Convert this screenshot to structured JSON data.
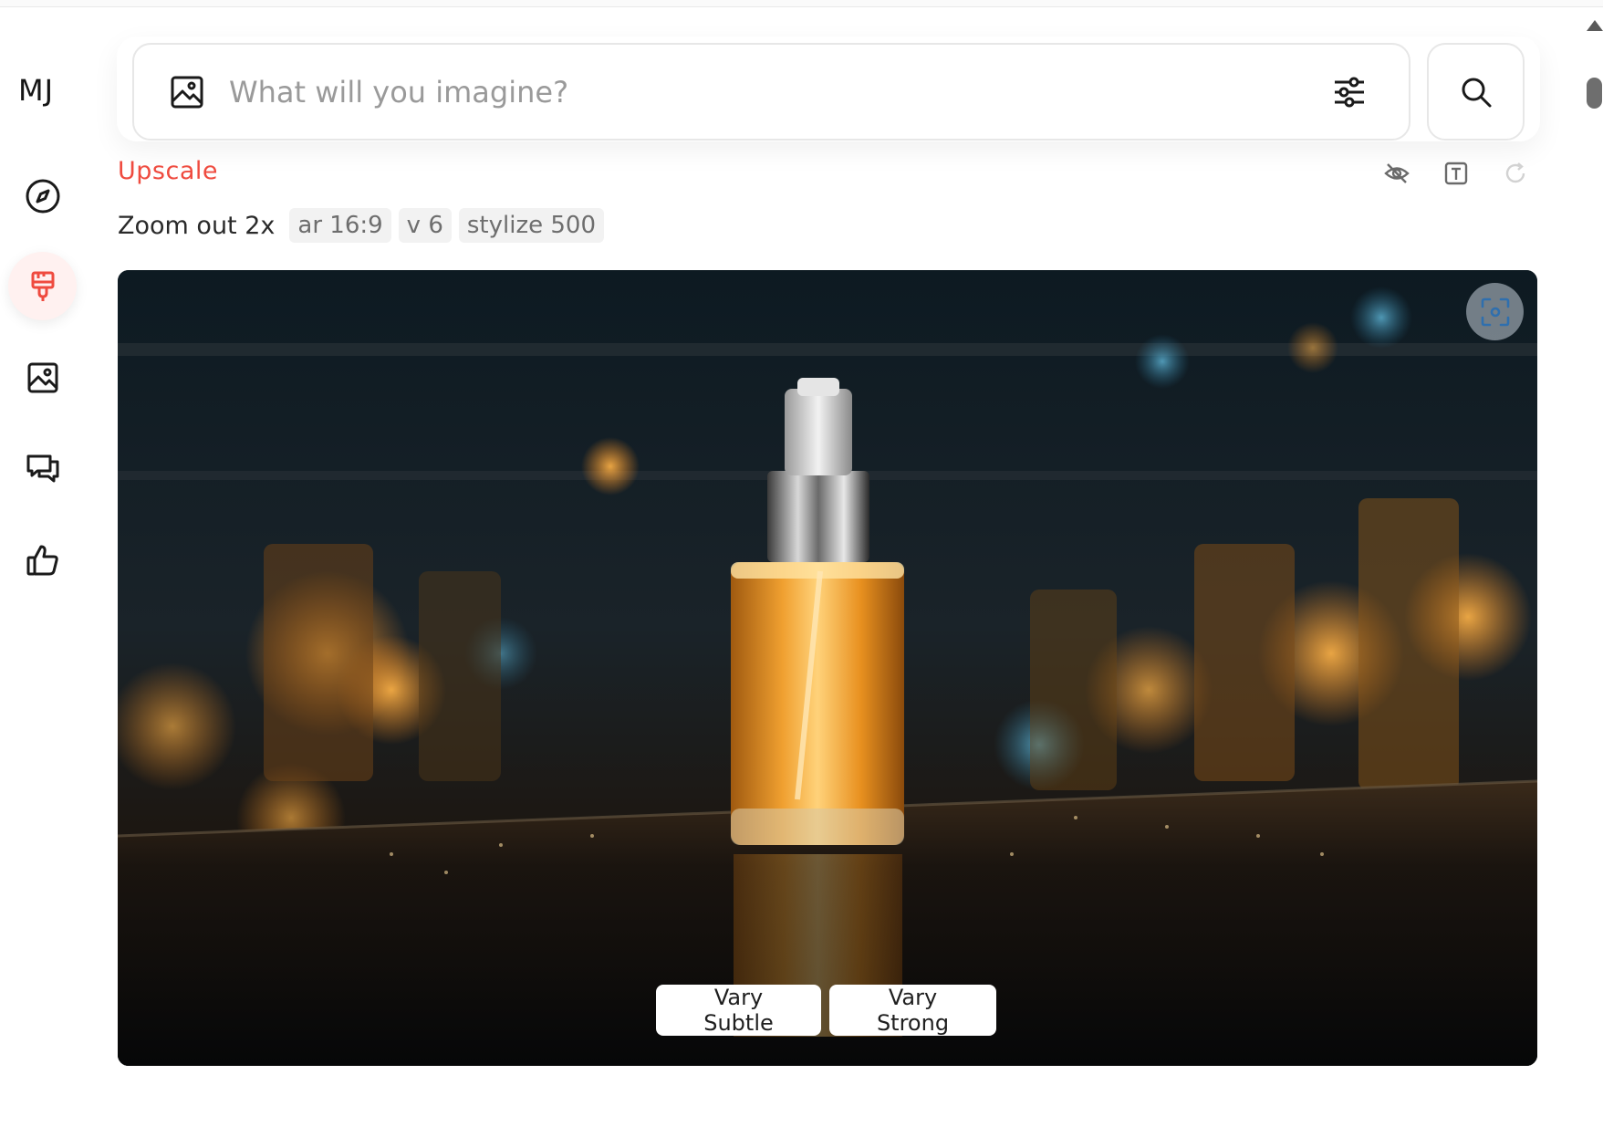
{
  "app": {
    "logo": "MJ"
  },
  "sidebar": {
    "items": [
      {
        "name": "explore",
        "icon": "compass-icon"
      },
      {
        "name": "create",
        "icon": "paintbrush-icon",
        "active": true
      },
      {
        "name": "organize",
        "icon": "image-icon"
      },
      {
        "name": "chat",
        "icon": "chat-bubbles-icon"
      },
      {
        "name": "rate",
        "icon": "thumbs-up-icon"
      }
    ]
  },
  "prompt": {
    "placeholder": "What will you imagine?",
    "value": ""
  },
  "job": {
    "action": "Upscale",
    "label": "Zoom out 2x",
    "tags": [
      "ar 16:9",
      "v 6",
      "stylize 500"
    ]
  },
  "image": {
    "buttons": {
      "vary_subtle": "Vary Subtle",
      "vary_strong": "Vary Strong"
    }
  },
  "colors": {
    "accent": "#ef4b3f",
    "active_bg": "#fff1f0"
  }
}
